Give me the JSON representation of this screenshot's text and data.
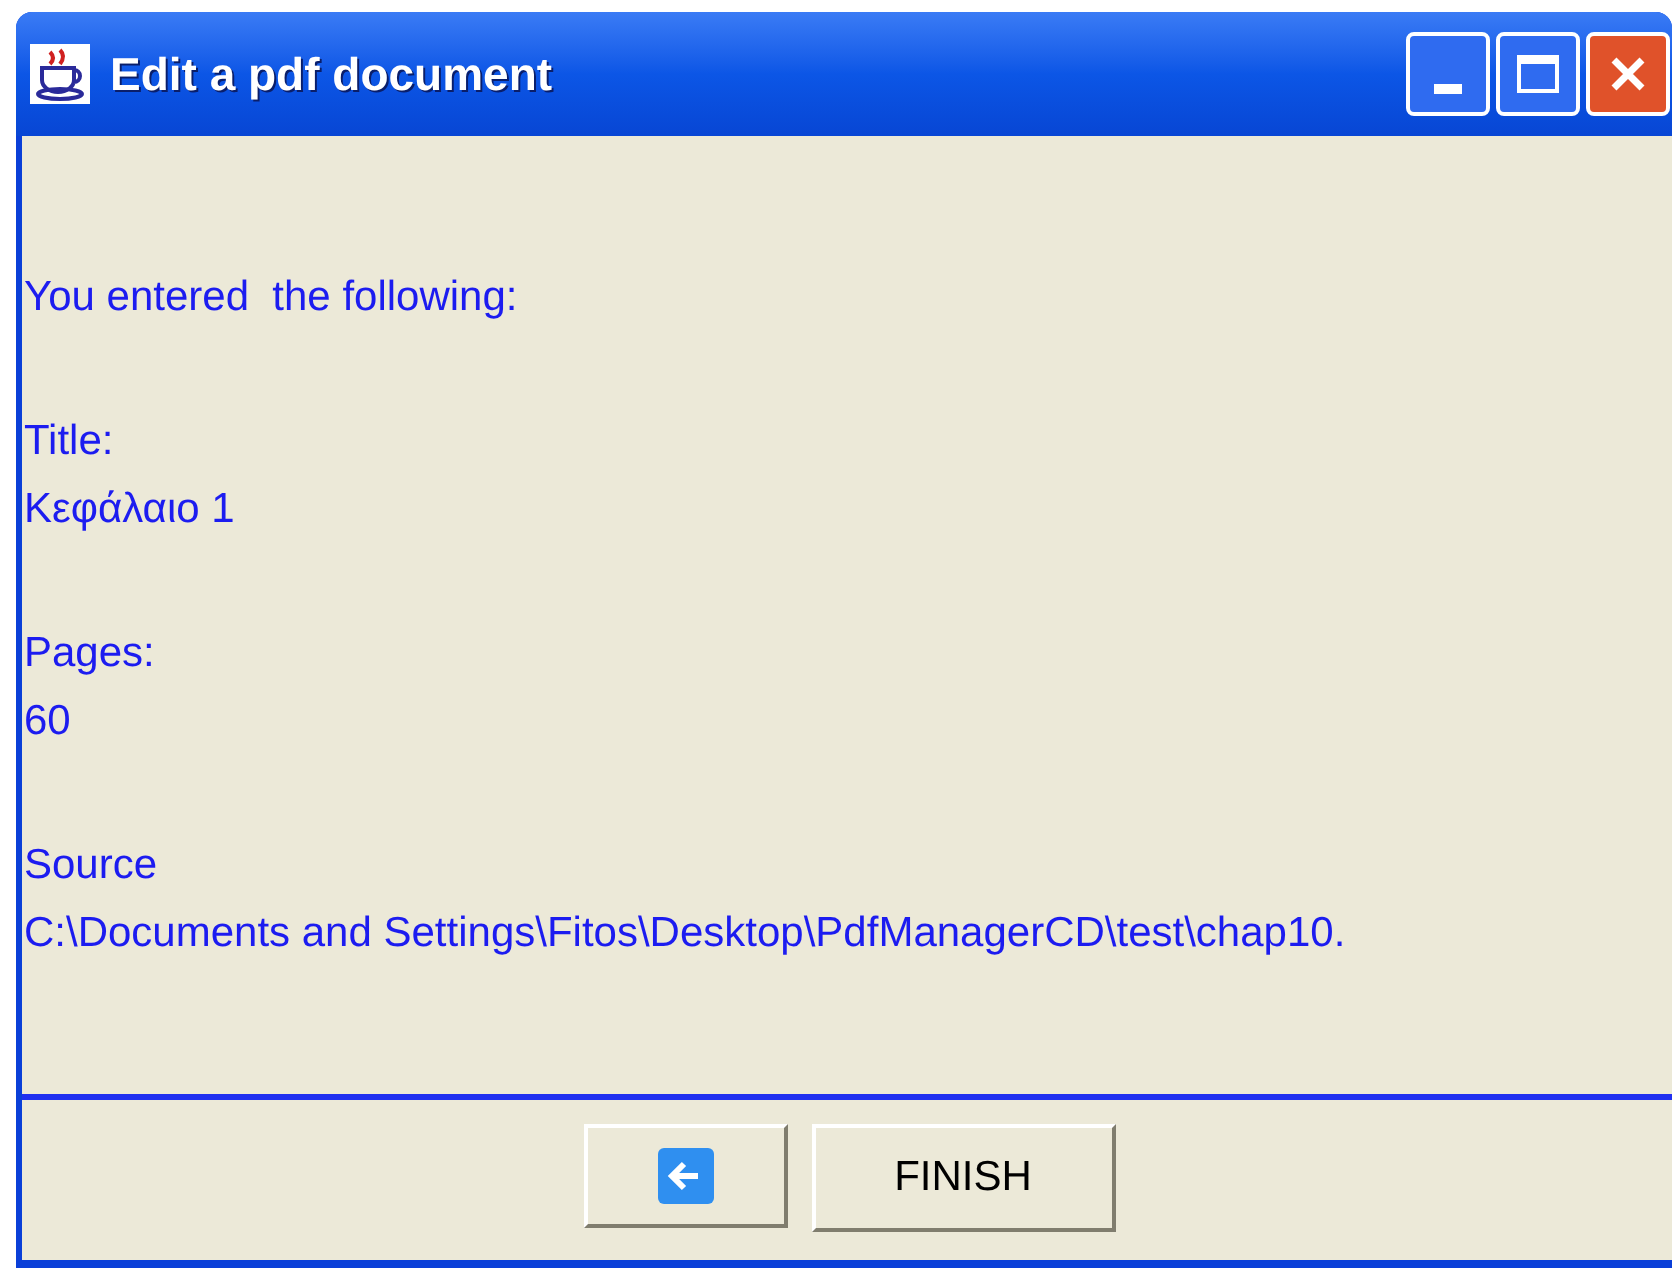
{
  "window": {
    "title": "Edit a pdf document"
  },
  "intro": "You entered  the following:",
  "fields": [
    {
      "label": "Title:",
      "value": "Κεφάλαιο 1"
    },
    {
      "label": "Pages:",
      "value": "60"
    },
    {
      "label": "Source",
      "value": "C:\\Documents and Settings\\Fitos\\Desktop\\PdfManagerCD\\test\\chap10."
    }
  ],
  "buttons": [
    {
      "kind": "back"
    },
    {
      "kind": "text",
      "label": "FINISH"
    }
  ]
}
